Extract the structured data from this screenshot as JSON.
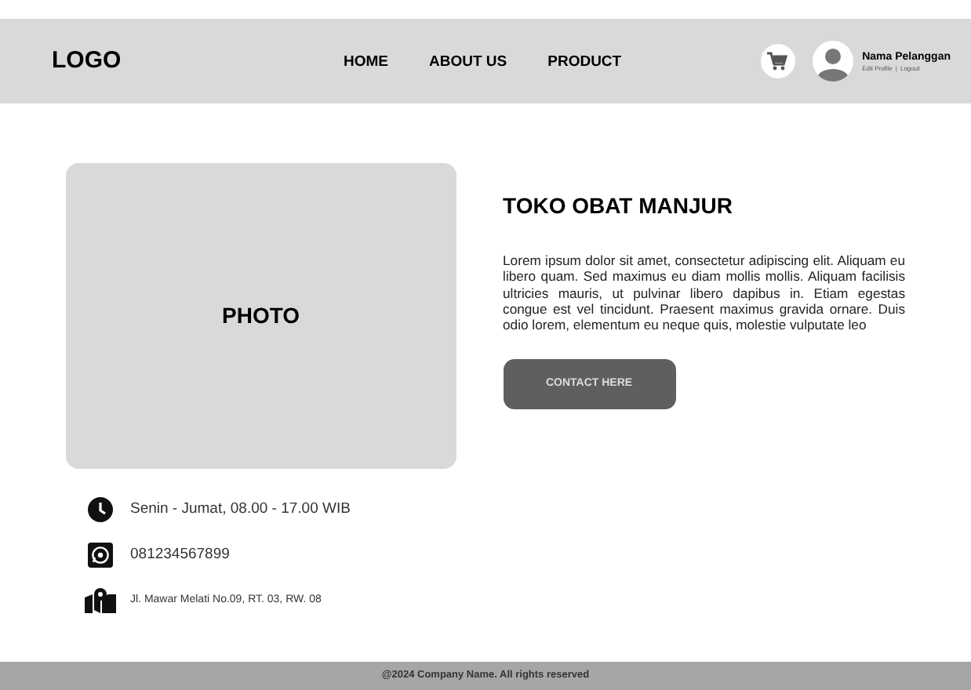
{
  "header": {
    "logo": "LOGO",
    "nav": [
      {
        "label": "HOME"
      },
      {
        "label": "ABOUT US"
      },
      {
        "label": "PRODUCT"
      }
    ],
    "user": {
      "name": "Nama Pelanggan",
      "links": [
        "Edit Profile",
        "Logout"
      ],
      "separator": "|"
    }
  },
  "photo": {
    "label": "PHOTO"
  },
  "contacts": [
    {
      "kind": "clock",
      "text": "Senin - Jumat, 08.00 - 17.00 WIB"
    },
    {
      "kind": "whatsapp",
      "text": "081234567899"
    },
    {
      "kind": "map",
      "text": "Jl. Mawar Melati No.09, RT. 03, RW. 08"
    }
  ],
  "title": "TOKO OBAT MANJUR",
  "description": "Lorem ipsum dolor sit amet, consectetur adipiscing elit. Aliquam eu libero quam. Sed maximus eu diam mollis mollis. Aliquam facilisis ultricies mauris, ut pulvinar libero dapibus in. Etiam egestas congue est vel tincidunt. Praesent maximus gravida ornare. Duis odio lorem, elementum eu neque quis, molestie vulputate leo",
  "button": "CONTACT HERE",
  "footer": "@2024 Company Name. All rights reserved"
}
